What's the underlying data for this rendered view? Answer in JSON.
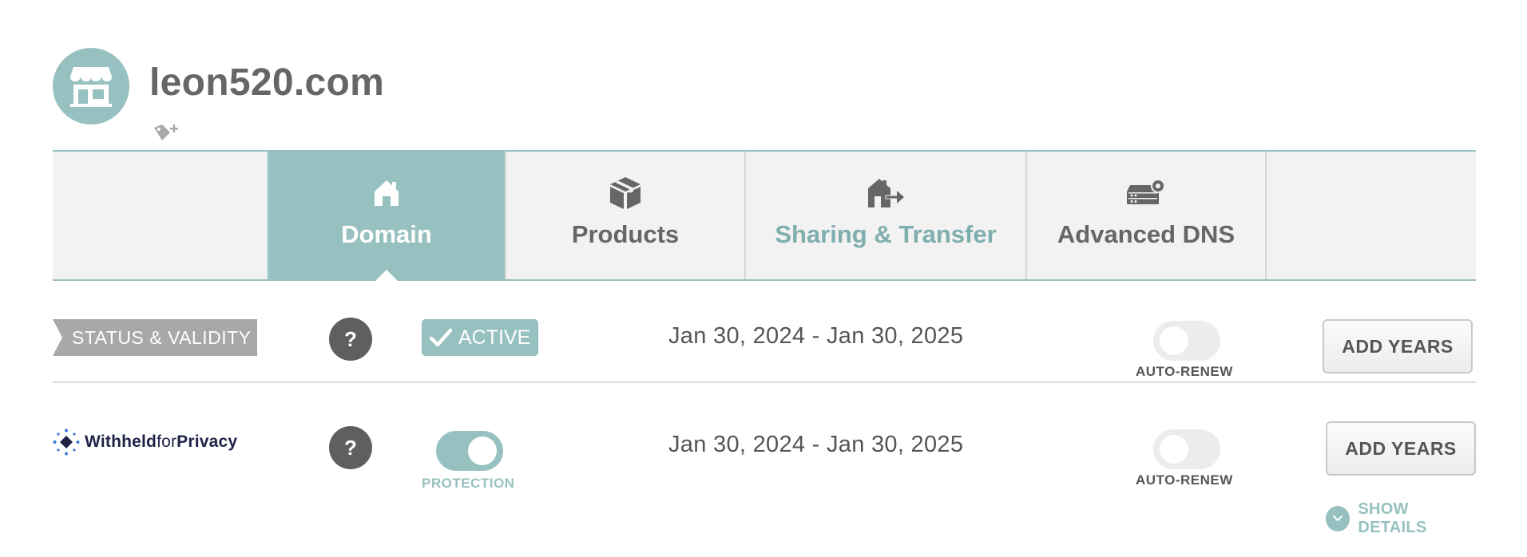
{
  "domain": {
    "name": "leon520.com",
    "avatar_icon": "storefront-icon",
    "tag_icon": "tag-add-icon"
  },
  "tabs": [
    {
      "label": "Domain",
      "icon": "house-icon",
      "active": true
    },
    {
      "label": "Products",
      "icon": "box-icon",
      "active": false
    },
    {
      "label": "Sharing & Transfer",
      "icon": "house-transfer-icon",
      "active": false
    },
    {
      "label": "Advanced DNS",
      "icon": "server-gear-icon",
      "active": false
    }
  ],
  "status_row": {
    "label": "STATUS & VALIDITY",
    "help": "?",
    "badge": "ACTIVE",
    "dates": "Jan 30, 2024 - Jan 30, 2025",
    "auto_renew_label": "AUTO-RENEW",
    "auto_renew_on": false,
    "add_years_label": "ADD YEARS"
  },
  "privacy_row": {
    "logo_bold": "Withheld",
    "logo_for": "for",
    "logo_privacy": "Privacy",
    "help": "?",
    "protection_label": "PROTECTION",
    "protection_on": true,
    "dates": "Jan 30, 2024 - Jan 30, 2025",
    "auto_renew_label": "AUTO-RENEW",
    "auto_renew_on": false,
    "add_years_label": "ADD YEARS",
    "show_details_label": "SHOW DETAILS"
  },
  "colors": {
    "accent": "#97c1c0",
    "tab_bg": "#f2f2f2",
    "status_label_bg": "#a8a8a8",
    "help_bg": "#5f5f5f"
  }
}
